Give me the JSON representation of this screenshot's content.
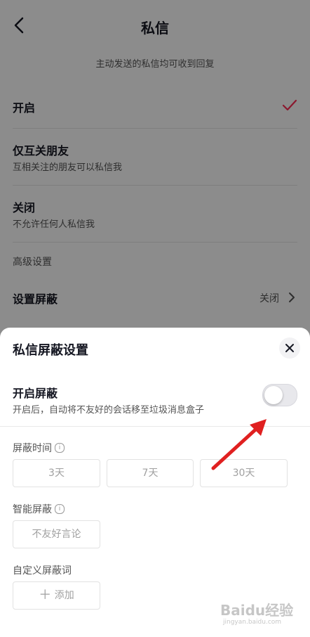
{
  "header": {
    "title": "私信"
  },
  "notice": "主动发送的私信均可收到回复",
  "options": [
    {
      "title": "开启",
      "subtitle": "",
      "selected": true
    },
    {
      "title": "仅互关朋友",
      "subtitle": "互相关注的朋友可以私信我",
      "selected": false
    },
    {
      "title": "关闭",
      "subtitle": "不允许任何人私信我",
      "selected": false
    }
  ],
  "advanced": {
    "section_label": "高级设置",
    "block_label": "设置屏蔽",
    "block_value": "关闭"
  },
  "sheet": {
    "title": "私信屏蔽设置",
    "toggle_title": "开启屏蔽",
    "toggle_subtitle": "开启后，自动将不友好的会话移至垃圾消息盒子",
    "toggle_on": false,
    "duration_label": "屏蔽时间",
    "durations": [
      "3天",
      "7天",
      "30天"
    ],
    "smart_label": "智能屏蔽",
    "smart_option": "不友好言论",
    "custom_label": "自定义屏蔽词",
    "add_label": "添加"
  },
  "colors": {
    "check": "#fe2c55",
    "arrow": "#e02020",
    "switch_off": "#e8e8ec"
  },
  "watermark": {
    "text": "Baidu经验",
    "sub": "jingyan.baidu.com"
  }
}
